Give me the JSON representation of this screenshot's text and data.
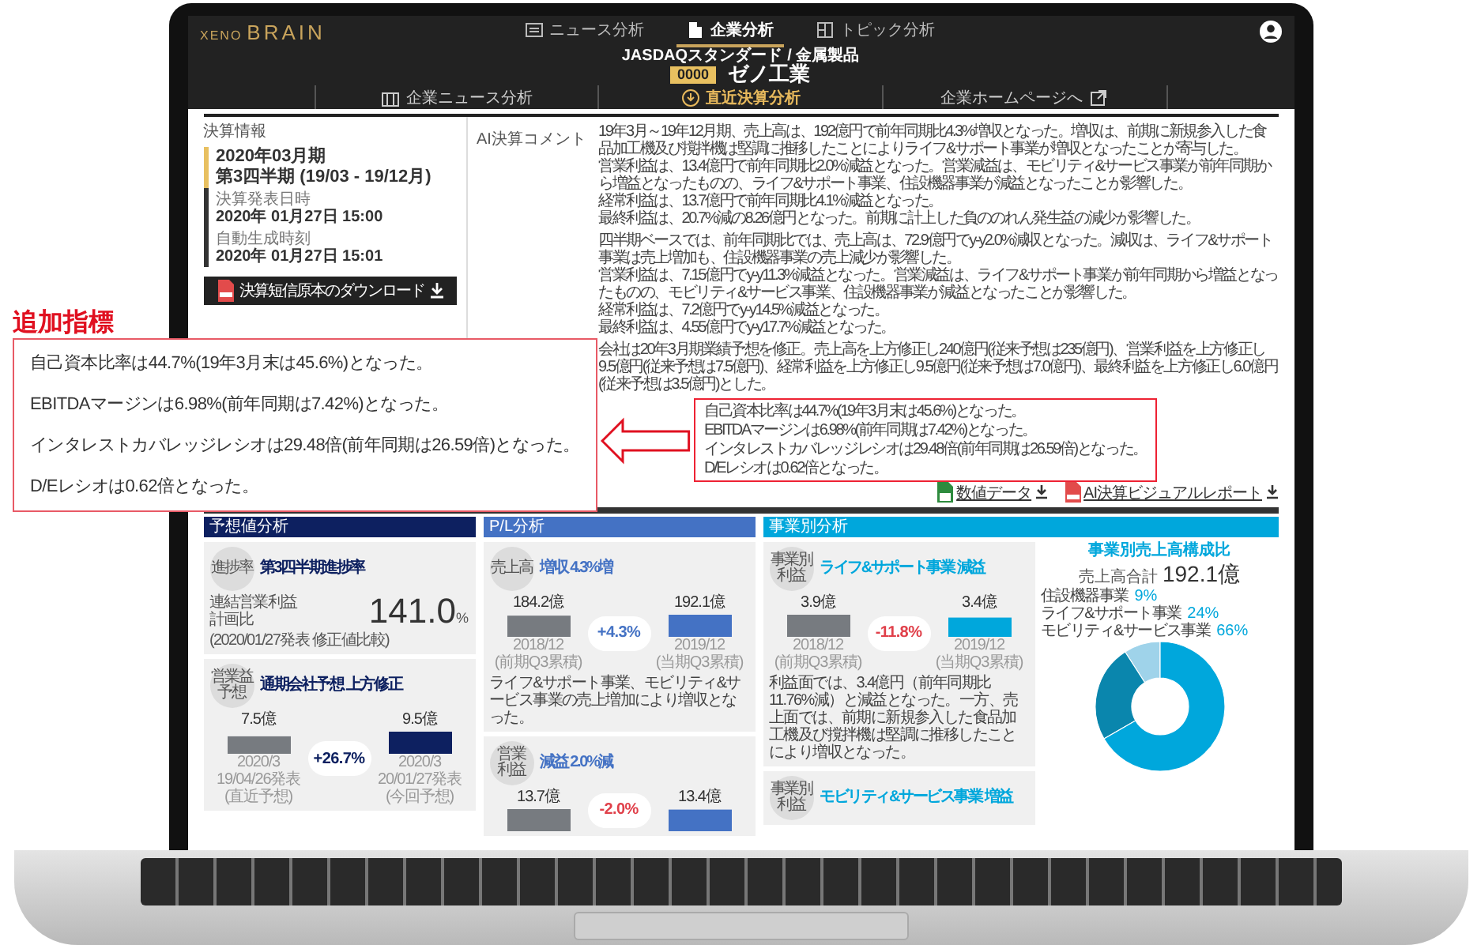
{
  "callout": {
    "title": "追加指標",
    "lines": [
      "自己資本比率は44.7%(19年3月末は45.6%)となった。",
      "EBITDAマージンは6.98%(前年同期は7.42%)となった。",
      "インタレストカバレッジレシオは29.48倍(前年同期は26.59倍)となった。",
      "D/Eレシオは0.62倍となった。"
    ]
  },
  "app": {
    "logo": [
      "XENO",
      "BRAIN"
    ],
    "nav_tabs": [
      {
        "label": "ニュース分析",
        "selected": false
      },
      {
        "label": "企業分析",
        "selected": true
      },
      {
        "label": "トピック分析",
        "selected": false
      }
    ],
    "company": {
      "market": "JASDAQスタンダード",
      "sector": "/ 金属製品",
      "code": "0000",
      "name": "ゼノ工業"
    },
    "sub_nav": [
      {
        "label": "企業ニュース分析",
        "selected": false
      },
      {
        "label": "直近決算分析",
        "selected": true
      },
      {
        "label": "企業ホームページへ",
        "selected": false
      }
    ],
    "summary": {
      "label": "決算情報",
      "period": "2020年03月期",
      "quarter": "第3四半期 (19/03 - 19/12月)",
      "items": [
        {
          "label": "決算発表日時",
          "value": "2020年 01月27日 15:00"
        },
        {
          "label": "自動生成時刻",
          "value": "2020年 01月27日 15:01"
        }
      ],
      "download_button": "決算短信原本のダウンロード"
    },
    "ai_comment": {
      "label": "AI決算コメント",
      "paragraphs": [
        [
          "19年3月～19年12月期、売上高は、192億円で前年同期比4.3%増収となった。増収は、前期に新規参入した食品加工機及び撹拌機は堅調に推移したことによりライフ&サポート事業が増収となったことが寄与した。",
          "営業利益は、13.4億円で前年同期比2.0%減益となった。営業減益は、モビリティ&サービス事業が前年同期から増益となったものの、ライフ&サポート事業、住設機器事業が減益となったことが影響した。",
          "経常利益は、13.7億円で前年同期比4.1%減益となった。",
          "最終利益は、20.7%減の8.26億円となった。前期に計上した負ののれん発生益の減少が影響した。"
        ],
        [
          "四半期ベースでは、前年同期比では、売上高は、72.9億円でy-y2.0%減収となった。減収は、ライフ&サポート事業は売上増加も、住設機器事業の売上減少が影響した。",
          "営業利益は、7.15億円でy-y11.3%減益となった。営業減益は、ライフ&サポート事業が前年同期から増益となったものの、モビリティ&サービス事業、住設機器事業が減益となったことが影響した。",
          "経常利益は、7.2億円でy-y14.5%減益となった。",
          "最終利益は、4.55億円でy-y17.7%減益となった。"
        ],
        [
          "会社は20年3月期業績予想を修正。売上高を上方修正し240億円(従来予想は235億円)、営業利益を上方修正し9.5億円(従来予想は7.5億円)、経常利益を上方修正し9.5億円(従来予想は7.0億円)、最終利益を上方修正し6.0億円(従来予想は3.5億円)とした。"
        ]
      ],
      "highlighted": [
        "自己資本比率は44.7%(19年3月末は45.6%)となった。",
        "EBITDAマージンは6.98%(前年同期は7.42%)となった。",
        "インタレストカバレッジレシオは29.48倍(前年同期は26.59倍)となった。",
        "D/Eレシオは0.62倍となった。"
      ]
    },
    "downloads": [
      {
        "label": "数値データ"
      },
      {
        "label": "AI決算ビジュアルレポート"
      }
    ],
    "forecast": {
      "title": "予想値分析",
      "progress": {
        "badge": "進捗率",
        "title": "第3四半期進捗率",
        "notes": [
          "連結営業利益",
          "計画比"
        ],
        "note_date": "(2020/01/27発表 修正値比較)",
        "value": "141.0",
        "unit": "%"
      },
      "revision": {
        "badge": "営業益予想",
        "title": "通期会社予想 上方修正",
        "change": {
          "text": "+26.7%",
          "color": "#0d2060"
        },
        "chart_data": {
          "type": "bar",
          "categories": [
            "2020/3\n19/04/26発表\n(直近予想)",
            "2020/3\n20/01/27発表\n(今回予想)"
          ],
          "values": [
            7.5,
            9.5
          ],
          "value_labels": [
            "7.5億",
            "9.5億"
          ]
        }
      }
    },
    "pl": {
      "title": "P/L分析",
      "cards": [
        {
          "badge": "売上高",
          "title": "増収 4.3%増",
          "change": {
            "text": "+4.3%",
            "color": "#4472c4"
          },
          "chart_data": {
            "type": "bar",
            "categories": [
              "2018/12\n(前期Q3累積)",
              "2019/12\n(当期Q3累積)"
            ],
            "values": [
              184.2,
              192.1
            ],
            "value_labels": [
              "184.2億",
              "192.1億"
            ]
          },
          "text": "ライフ&サポート事業、モビリティ&サービス事業の売上増加により増収となった。"
        },
        {
          "badge": "営業利益",
          "title": "減益 2.0%減",
          "change": {
            "text": "-2.0%",
            "color": "#e0404a"
          },
          "chart_data": {
            "type": "bar",
            "values": [
              13.7,
              13.4
            ],
            "value_labels": [
              "13.7億",
              "13.4億"
            ]
          }
        }
      ]
    },
    "segment": {
      "title": "事業別分析",
      "cards": [
        {
          "badge": "事業別利益",
          "title": "ライフ&サポート事業 減益",
          "change": {
            "text": "-11.8%",
            "color": "#e0404a"
          },
          "chart_data": {
            "type": "bar",
            "categories": [
              "2018/12\n(前期Q3累積)",
              "2019/12\n(当期Q3累積)"
            ],
            "values": [
              3.9,
              3.4
            ],
            "value_labels": [
              "3.9億",
              "3.4億"
            ]
          },
          "text": "利益面では、3.4億円（前年同期比11.76%減）と減益となった。一方、売上面では、前期に新規参入した食品加工機及び撹拌機は堅調に推移したことにより増収となった。"
        },
        {
          "badge": "事業別利益",
          "title": "モビリティ&サービス事業 増益"
        }
      ],
      "composition": {
        "total_label": "売上高合計",
        "total": "192.1億",
        "chart_data": {
          "type": "donut",
          "title": "事業別売上高構成比",
          "categories": [
            "住設機器事業",
            "ライフ&サポート事業",
            "モビリティ&サービス事業"
          ],
          "values": [
            9,
            24,
            66
          ],
          "value_labels": [
            "9%",
            "24%",
            "66%"
          ]
        }
      }
    }
  }
}
